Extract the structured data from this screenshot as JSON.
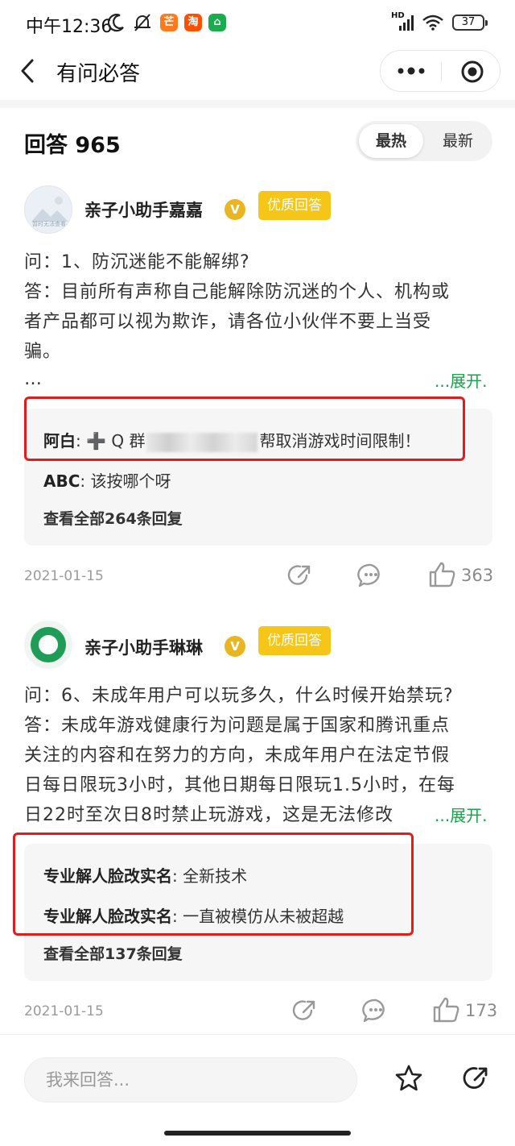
{
  "status_bar": {
    "time": "中午12:36",
    "network": "HD",
    "battery": "37",
    "apps": [
      {
        "icon": "mango-app-icon",
        "glyph": "芒",
        "color": "#ff7a1a"
      },
      {
        "icon": "taobao-app-icon",
        "glyph": "淘",
        "color": "#ff5000"
      },
      {
        "icon": "home-app-icon",
        "glyph": "⌂",
        "color": "#1aad4f"
      }
    ]
  },
  "nav": {
    "back_icon": "back-arrow-icon",
    "title": "有问必答",
    "more_icon": "more-dots-icon",
    "close_icon": "target-close-icon"
  },
  "answers_header": {
    "title": "回答 965",
    "sort_options": [
      "最热",
      "最新"
    ],
    "selected_sort": "最热"
  },
  "answers": [
    {
      "author": "亲子小助手嘉嘉",
      "avatar_icon": "image-placeholder-avatar",
      "avatar_text": "暂时无法查看",
      "verified_mark": "V",
      "badge": "优质回答",
      "lines": [
        "问：1、防沉迷能不能解绑?",
        "答：目前所有声称自己能解除防沉迷的个人、机构或",
        "者产品都可以视为欺诈，请各位小伙伴不要上当受",
        "骗。"
      ],
      "ellipsis": "…",
      "expand_label": "...展开.",
      "comments": [
        {
          "user": "阿白",
          "colon": ": ",
          "text_before": "➕ Q 群",
          "text_after": "帮取消游戏时间限制！"
        },
        {
          "user": "ABC",
          "colon": ": ",
          "text": "该按哪个呀"
        }
      ],
      "view_all": "查看全部264条回复",
      "date": "2021-01-15",
      "likes": "363"
    },
    {
      "author": "亲子小助手琳琳",
      "avatar_icon": "green-chat-avatar",
      "verified_mark": "V",
      "badge": "优质回答",
      "lines": [
        "问：6、未成年用户可以玩多久，什么时候开始禁玩?",
        "答：未成年游戏健康行为问题是属于国家和腾讯重点",
        "关注的内容和在努力的方向，未成年用户在法定节假",
        "日每日限玩3小时，其他日期每日限玩1.5小时，在每",
        "日22时至次日8时禁止玩游戏，这是无法修改"
      ],
      "expand_label": "...展开.",
      "comments": [
        {
          "user": "专业解人脸改实名",
          "colon": ": ",
          "text": "全新技术"
        },
        {
          "user": "专业解人脸改实名",
          "colon": ": ",
          "text": "一直被模仿从未被超越"
        }
      ],
      "view_all": "查看全部137条回复",
      "date": "2021-01-15",
      "likes": "173"
    }
  ],
  "bottom_bar": {
    "input_placeholder": "我来回答...",
    "favorite_icon": "star-icon",
    "share_icon": "share-icon"
  },
  "colors": {
    "accent_green": "#17a34a",
    "badge_yellow": "#f5c518",
    "highlight_red": "#e21b1b"
  }
}
